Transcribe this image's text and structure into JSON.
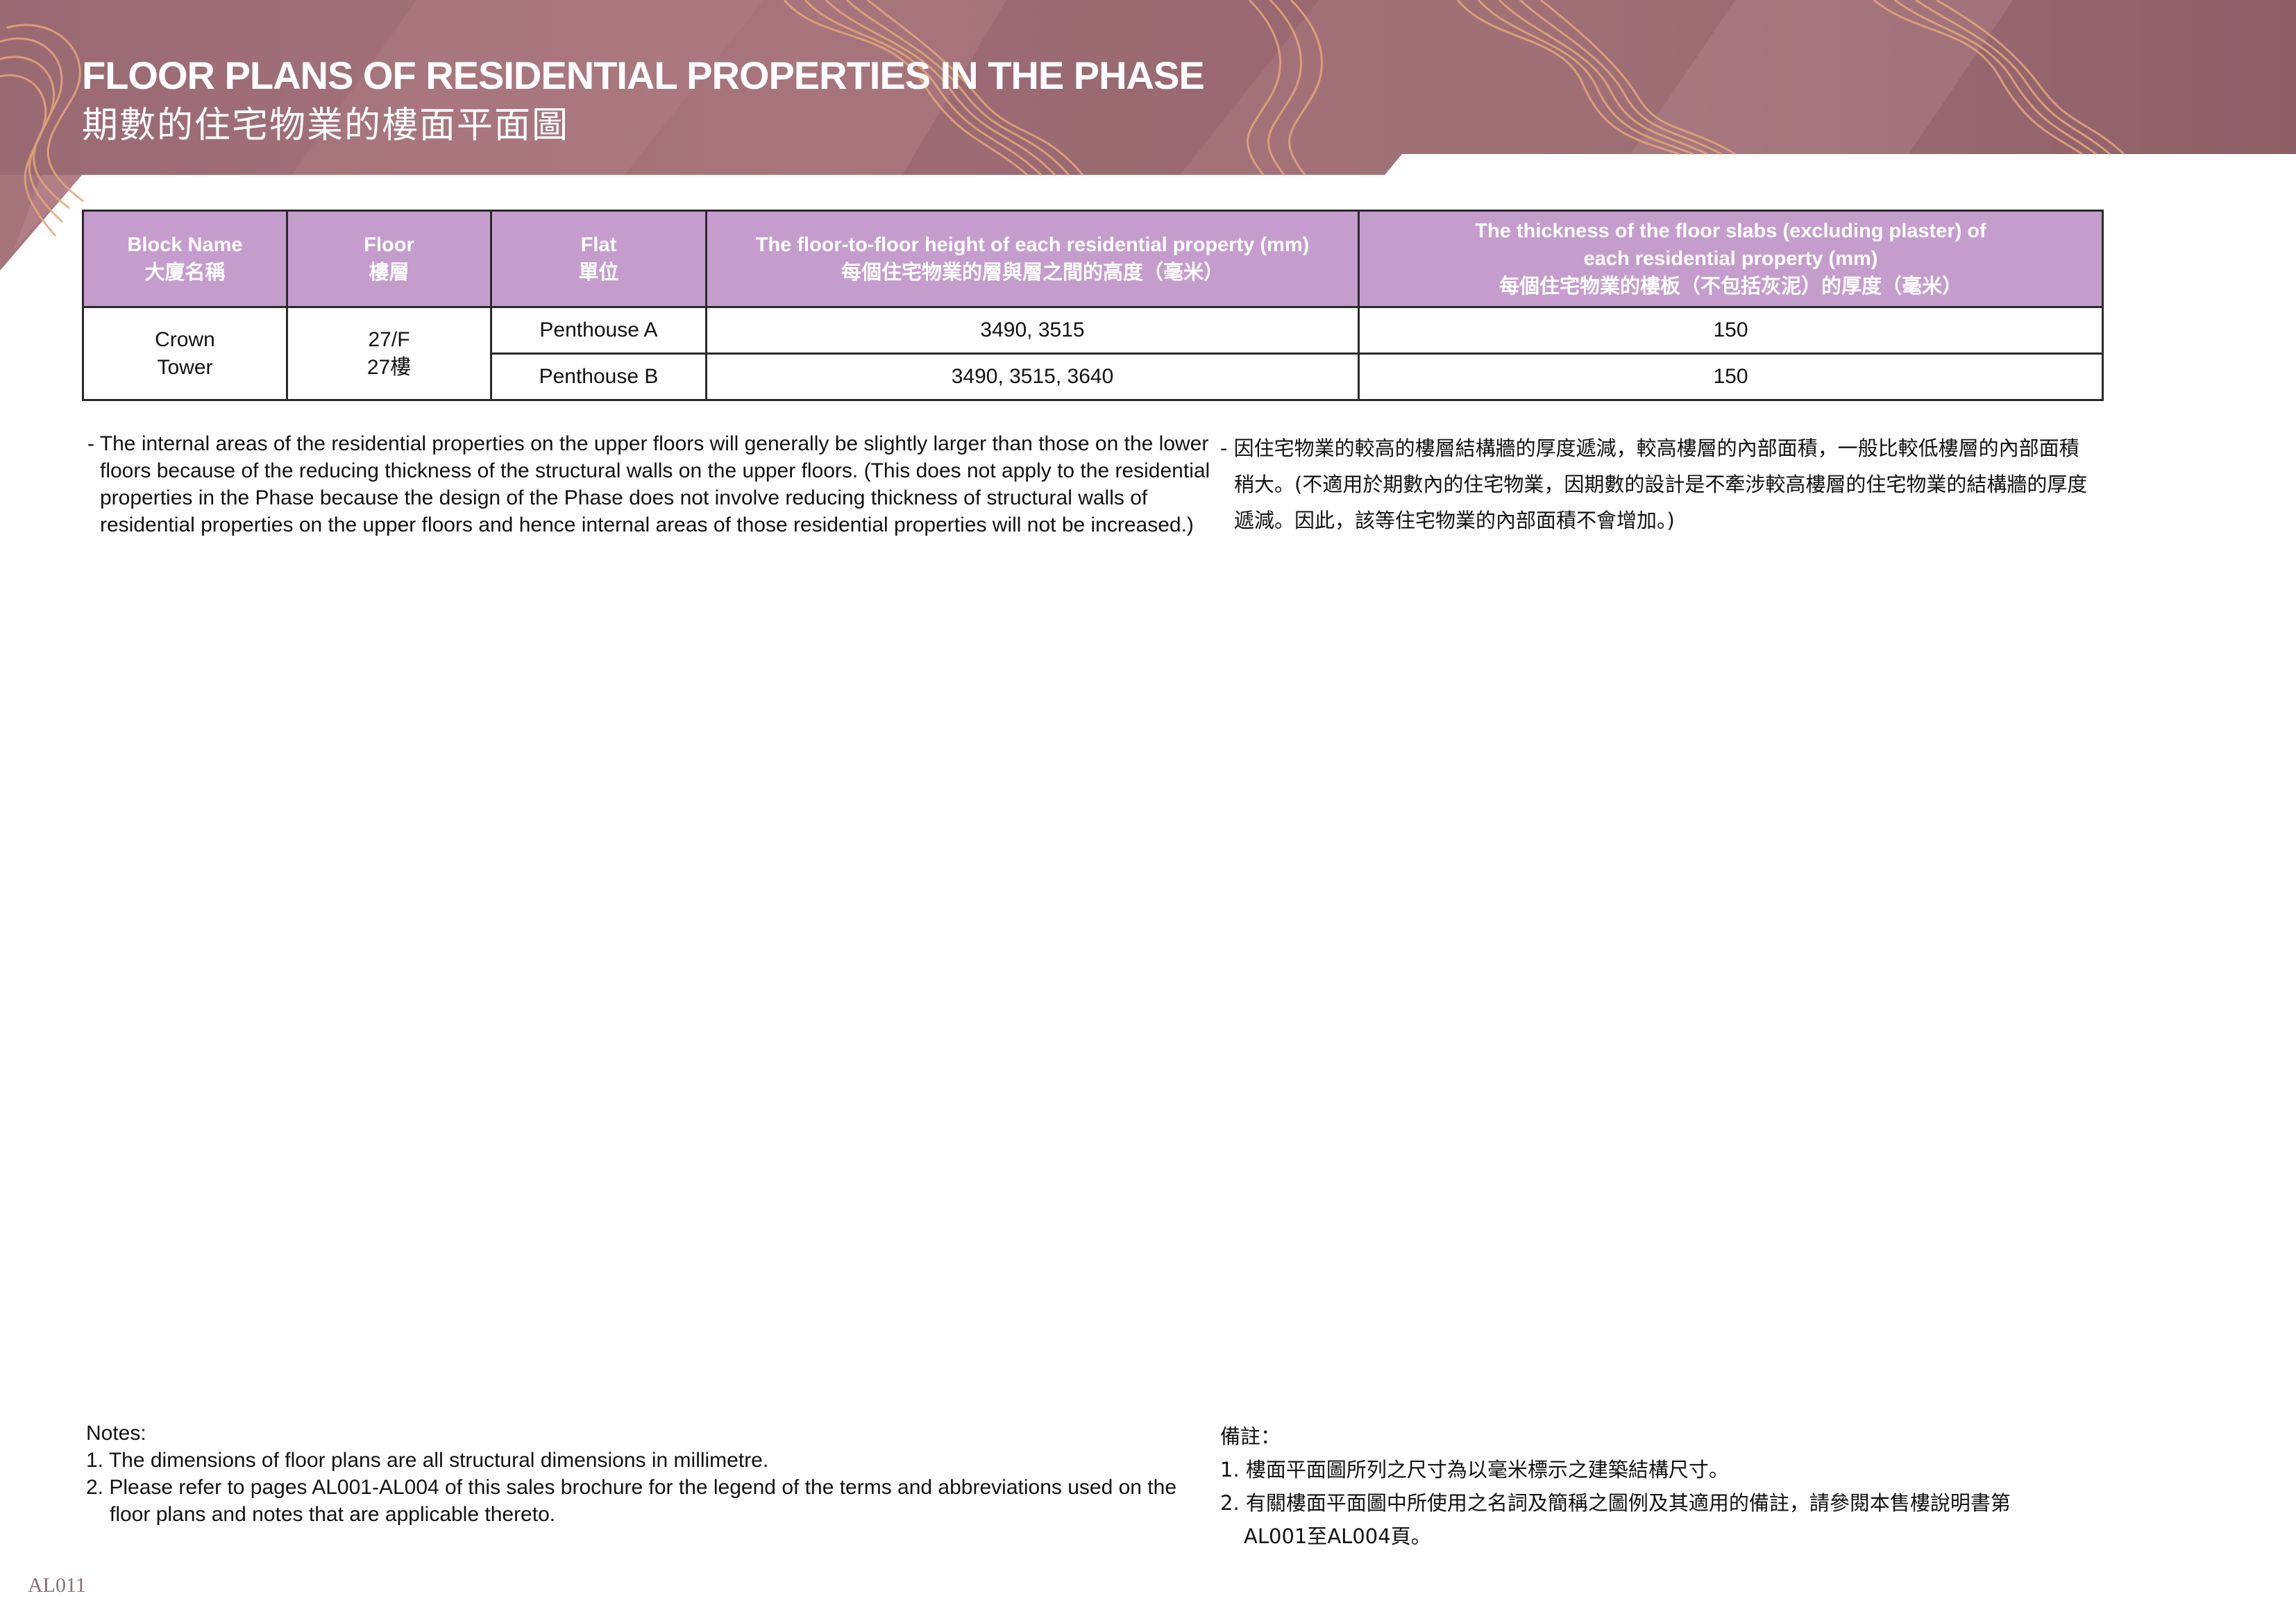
{
  "header": {
    "title_en": "FLOOR PLANS OF RESIDENTIAL PROPERTIES IN THE PHASE",
    "title_zh": "期數的住宅物業的樓面平面圖",
    "banner_color": "#9e6b72",
    "pattern_color": "#e3a77a"
  },
  "table": {
    "header_bg": "#c59dcd",
    "columns": [
      {
        "en": "Block Name",
        "zh": "大廈名稱"
      },
      {
        "en": "Floor",
        "zh": "樓層"
      },
      {
        "en": "Flat",
        "zh": "單位"
      },
      {
        "en": "The floor-to-floor height of each residential property (mm)",
        "zh": "每個住宅物業的層與層之間的高度（毫米）"
      },
      {
        "en_line1": "The thickness of the floor slabs (excluding plaster) of",
        "en_line2": "each residential property (mm)",
        "zh": "每個住宅物業的樓板（不包括灰泥）的厚度（毫米）"
      }
    ],
    "block": {
      "line1": "Crown",
      "line2": "Tower"
    },
    "floor": {
      "line1": "27/F",
      "line2": "27樓"
    },
    "rows": [
      {
        "flat": "Penthouse A",
        "height": "3490, 3515",
        "thickness": "150"
      },
      {
        "flat": "Penthouse B",
        "height": "3490, 3515, 3640",
        "thickness": "150"
      }
    ]
  },
  "remark": {
    "en": "- The internal areas of the residential properties on the upper floors will generally be slightly larger than those on the lower floors because of the reducing thickness of the structural walls on the upper floors. (This does not apply to the residential properties in the Phase because the design of the Phase does not involve reducing thickness of structural walls of residential properties on the upper floors and hence internal areas of those residential properties will not be increased.)",
    "zh": "- 因住宅物業的較高的樓層結構牆的厚度遞減，較高樓層的內部面積，一般比較低樓層的內部面積稍大。(不適用於期數內的住宅物業，因期數的設計是不牽涉較高樓層的住宅物業的結構牆的厚度遞減。因此，該等住宅物業的內部面積不會增加。)"
  },
  "notes": {
    "en_heading": "Notes:",
    "en_items": [
      "1. The dimensions of floor plans are all structural dimensions in millimetre.",
      "2. Please refer to pages AL001-AL004 of this sales brochure for the legend of the terms and abbreviations used on the floor plans and notes that are applicable thereto."
    ],
    "zh_heading": "備註：",
    "zh_items": [
      "1. 樓面平面圖所列之尺寸為以毫米標示之建築結構尺寸。",
      "2. 有關樓面平面圖中所使用之名詞及簡稱之圖例及其適用的備註，請參閱本售樓說明書第AL001至AL004頁。"
    ]
  },
  "page_number": "AL011"
}
